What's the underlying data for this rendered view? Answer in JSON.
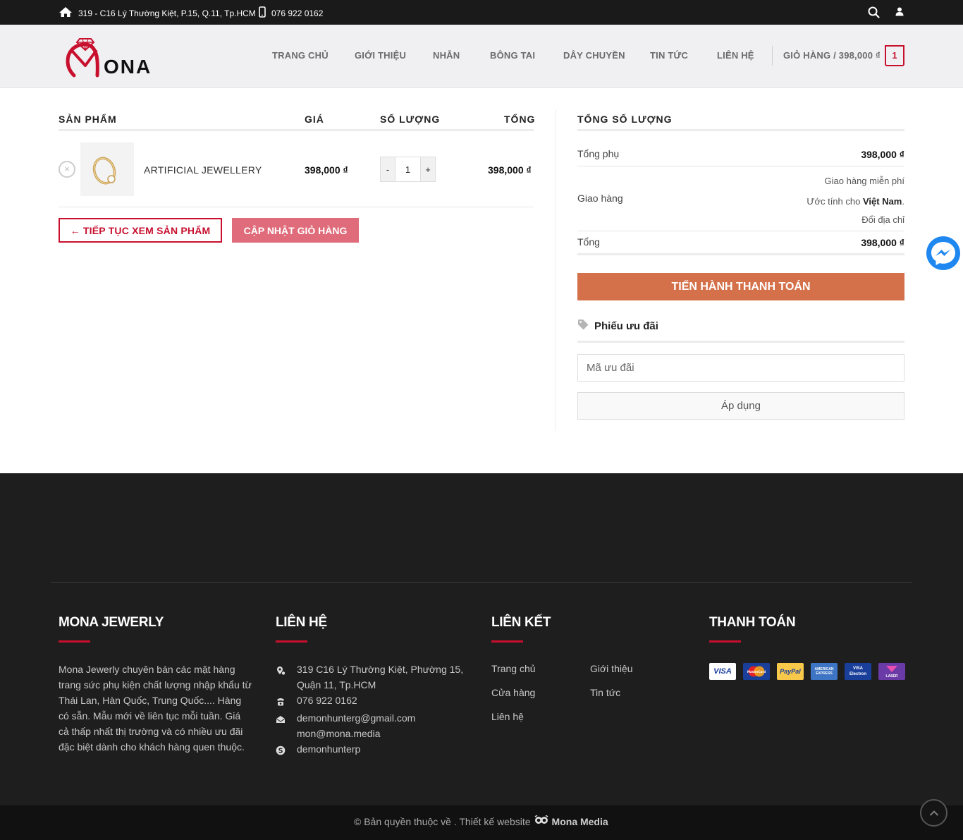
{
  "topbar": {
    "address": "319 - C16 Lý Thường Kiệt, P.15, Q.11, Tp.HCM",
    "phone": "076 922 0162"
  },
  "header": {
    "logo_text": "ONA",
    "nav": [
      "TRANG CHỦ",
      "GIỚI THIỆU",
      "NHẪN",
      "BÔNG TAI",
      "DÂY CHUYỀN",
      "TIN TỨC",
      "LIÊN HỆ"
    ],
    "cart_label": "GIỎ HÀNG / 398,000 ₫",
    "cart_count": "1"
  },
  "cart": {
    "headers": {
      "product": "SẢN PHẨM",
      "price": "GIÁ",
      "quantity": "SỐ LƯỢNG",
      "total": "TỔNG"
    },
    "item": {
      "remove": "×",
      "name": "ARTIFICIAL JEWELLERY",
      "price": "398,000 ₫",
      "qty_minus": "-",
      "qty": "1",
      "qty_plus": "+",
      "total": "398,000 ₫"
    },
    "continue_label": "← TIẾP TỤC XEM SẢN PHẨM",
    "update_label": "CẬP NHẬT GIỎ HÀNG"
  },
  "totals": {
    "heading": "TỔNG SỐ LƯỢNG",
    "subtotal_label": "Tổng phụ",
    "subtotal": "398,000 ₫",
    "shipping_label": "Giao hàng",
    "shipping_free": "Giao hàng miễn phí",
    "estimate_prefix": "Ước tính cho",
    "estimate_country": "Việt Nam",
    "change_address": "Đổi địa chỉ",
    "total_label": "Tổng",
    "total": "398,000 ₫",
    "checkout_label": "TIẾN HÀNH THANH TOÁN",
    "coupon_heading": "Phiếu ưu đãi",
    "coupon_placeholder": "Mã ưu đãi",
    "apply_label": "Áp dụng"
  },
  "footer": {
    "about_title": "MONA JEWERLY",
    "about_text": "Mona Jewerly chuyên bán các mặt hàng trang sức phụ kiện chất lượng nhập khẩu từ Thái Lan, Hàn Quốc, Trung Quốc.... Hàng có sẵn. Mẫu mới về liên tục mỗi tuần. Giá cả thấp nhất thị trường và có nhiều ưu đãi đặc biệt dành cho khách hàng quen thuộc.",
    "contact_title": "LIÊN HỆ",
    "contact_address": "319 C16 Lý Thường Kiệt, Phường 15, Quận 11, Tp.HCM",
    "contact_phone": "076 922 0162",
    "contact_email1": "demonhunterg@gmail.com",
    "contact_email2": "mon@mona.media",
    "contact_skype": "demonhunterp",
    "links_title": "LIÊN KẾT",
    "links": [
      "Trang chủ",
      "Giới thiệu",
      "Cửa hàng",
      "Tin tức",
      "Liên hệ"
    ],
    "payment_title": "THANH TOÁN",
    "payments": [
      "VISA",
      "MasterCard",
      "PayPal",
      "AMERICAN EXPRESS",
      "VISA Electron",
      "LASER"
    ]
  },
  "bottom": {
    "copyright": "© Bản quyền thuộc về . Thiết kế website",
    "brand": "Mona Media"
  },
  "colors": {
    "accent": "#c8102e",
    "checkout": "#d4704a",
    "update": "#e06b7a",
    "footer_bg": "#1e1e1e"
  }
}
